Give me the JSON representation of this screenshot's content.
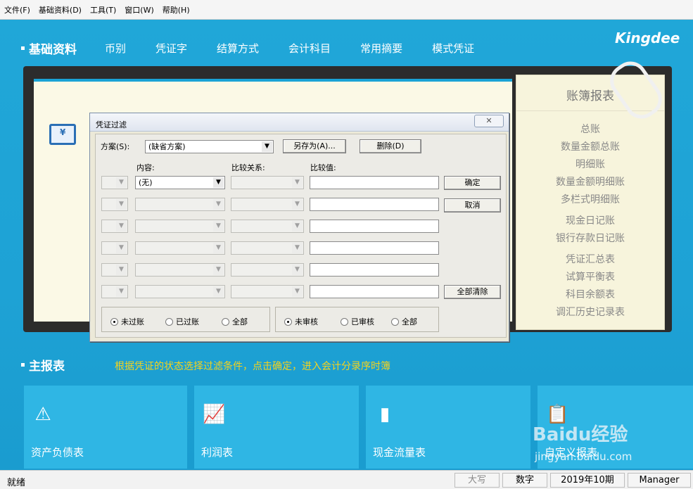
{
  "menu": [
    "文件(F)",
    "基础资料(D)",
    "工具(T)",
    "窗口(W)",
    "帮助(H)"
  ],
  "nav": {
    "title": "基础资料",
    "tabs": [
      "币别",
      "凭证字",
      "结算方式",
      "会计科目",
      "常用摘要",
      "模式凭证"
    ]
  },
  "logo": "Kingdee",
  "right_panel": {
    "title": "账簿报表",
    "items": [
      "总账",
      "数量金额总账",
      "明细账",
      "数量金额明细账",
      "多栏式明细账",
      "现金日记账",
      "银行存款日记账",
      "凭证汇总表",
      "试算平衡表",
      "科目余额表",
      "调汇历史记录表"
    ]
  },
  "main_reports": {
    "title": "主报表",
    "hint": "根据凭证的状态选择过滤条件，点击确定，进入会计分录序时簿",
    "tiles": [
      {
        "label": "资产负债表",
        "icon": "warning-triangle-icon"
      },
      {
        "label": "利润表",
        "icon": "line-chart-icon"
      },
      {
        "label": "现金流量表",
        "icon": "bar-chart-icon"
      },
      {
        "label": "自定义报表",
        "icon": "clipboard-icon"
      }
    ]
  },
  "dialog": {
    "title": "凭证过滤",
    "scheme_label": "方案(S):",
    "scheme_value": "(缺省方案)",
    "save_as": "另存为(A)...",
    "delete": "删除(D)",
    "col_content": "内容:",
    "col_relation": "比较关系:",
    "col_value": "比较值:",
    "row1_content": "(无)",
    "ok": "确定",
    "cancel": "取消",
    "clear_all": "全部清除",
    "post_options": [
      "未过账",
      "已过账",
      "全部"
    ],
    "post_selected": 0,
    "audit_options": [
      "未审核",
      "已审核",
      "全部"
    ],
    "audit_selected": 0
  },
  "status": {
    "ready": "就绪",
    "caps": "大写",
    "num": "数字",
    "period": "2019年10期",
    "user": "Manager"
  },
  "watermark": {
    "brand": "Baidu经验",
    "url": "jingyan.baidu.com"
  }
}
